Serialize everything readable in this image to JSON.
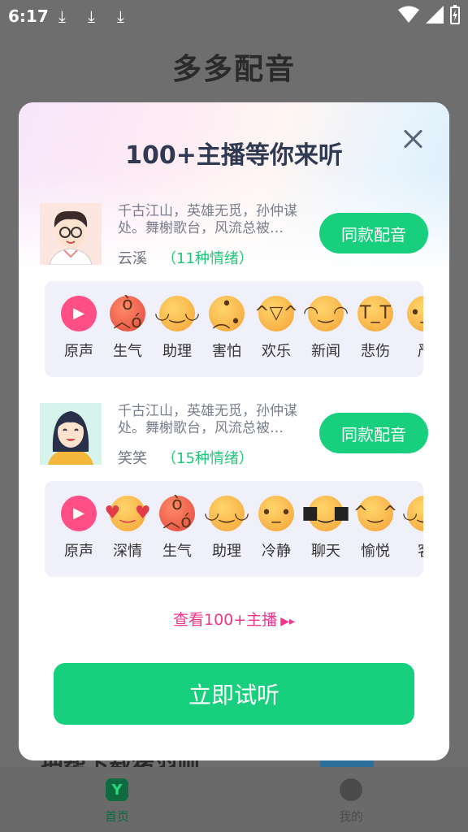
{
  "status": {
    "time": "6:17",
    "download_icons": [
      "download-icon",
      "download-icon",
      "download-icon"
    ]
  },
  "app": {
    "title": "多多配音",
    "bg_text": "把帮下载猪羽则"
  },
  "nav": [
    {
      "label": "首页",
      "icon": "home-icon"
    },
    {
      "label": "我的",
      "icon": "profile-icon"
    }
  ],
  "modal": {
    "title": "100+主播等你来听",
    "anchors": [
      {
        "desc": "千古江山，英雄无觅，孙仲谋处。舞榭歌台，风流总被…",
        "name": "云溪",
        "emotion_count": "（11种情绪）",
        "button": "同款配音",
        "emotions": [
          {
            "label": "原声",
            "icon": "play-icon"
          },
          {
            "label": "生气",
            "icon": "angry-face-icon"
          },
          {
            "label": "助理",
            "icon": "smile-face-icon"
          },
          {
            "label": "害怕",
            "icon": "afraid-face-icon"
          },
          {
            "label": "欢乐",
            "icon": "laugh-face-icon"
          },
          {
            "label": "新闻",
            "icon": "grin-face-icon"
          },
          {
            "label": "悲伤",
            "icon": "crying-face-icon"
          },
          {
            "label": "严",
            "icon": "serious-face-icon"
          }
        ]
      },
      {
        "desc": "千古江山，英雄无觅，孙仲谋处。舞榭歌台，风流总被…",
        "name": "笑笑",
        "emotion_count": "（15种情绪）",
        "button": "同款配音",
        "emotions": [
          {
            "label": "原声",
            "icon": "play-icon"
          },
          {
            "label": "深情",
            "icon": "heart-eyes-face-icon"
          },
          {
            "label": "生气",
            "icon": "angry-face-icon"
          },
          {
            "label": "助理",
            "icon": "smile-face-icon"
          },
          {
            "label": "冷静",
            "icon": "neutral-face-icon"
          },
          {
            "label": "聊天",
            "icon": "sunglasses-face-icon"
          },
          {
            "label": "愉悦",
            "icon": "happy-face-icon"
          },
          {
            "label": "客",
            "icon": "smile-face-icon"
          }
        ]
      }
    ],
    "more_link": "查看100+主播",
    "listen_button": "立即试听"
  }
}
